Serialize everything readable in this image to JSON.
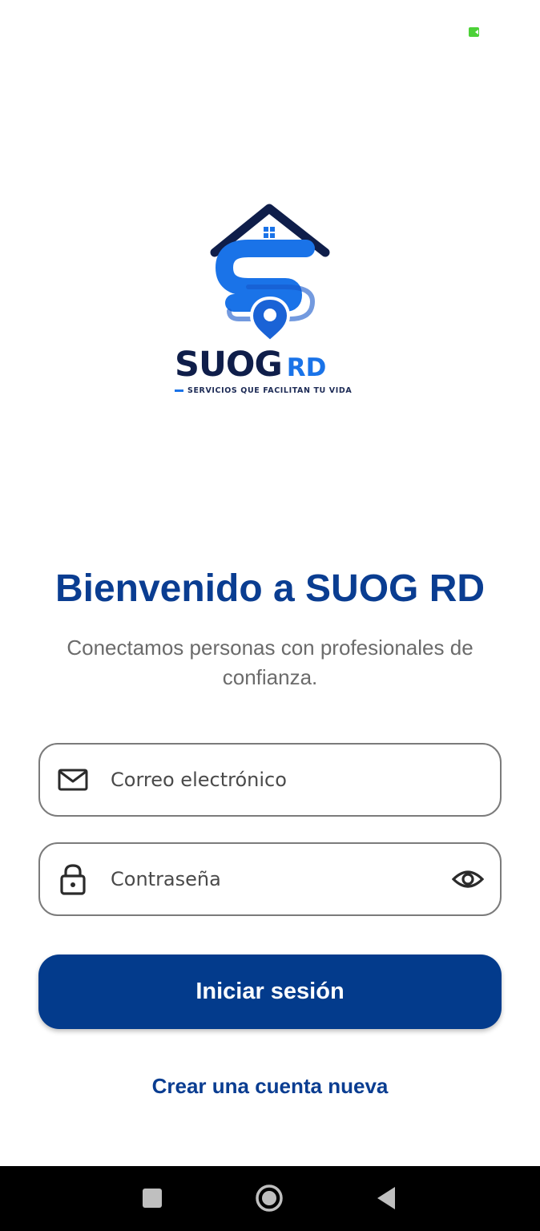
{
  "status_bar": {
    "indicator_icon": "camera-indicator-icon",
    "indicator_color": "#4cd137"
  },
  "logo": {
    "word": "SUOG",
    "suffix": "RD",
    "tagline": "SERVICIOS QUE FACILITAN TU VIDA",
    "colors": {
      "dark": "#0f1e4a",
      "blue": "#1a73e8"
    }
  },
  "welcome": {
    "title": "Bienvenido a SUOG RD",
    "subtitle": "Conectamos personas con profesionales de confianza."
  },
  "form": {
    "email": {
      "placeholder": "Correo electrónico",
      "value": "",
      "icon": "mail-icon"
    },
    "password": {
      "placeholder": "Contraseña",
      "value": "",
      "icon": "lock-icon",
      "toggle_icon": "eye-icon"
    },
    "login_label": "Iniciar sesión",
    "create_account_label": "Crear una cuenta nueva"
  },
  "theme": {
    "primary": "#033b8c",
    "title_color": "#0a3d91",
    "subtitle_color": "#6b6b6b"
  },
  "navbar": {
    "buttons": [
      "recents-icon",
      "home-icon",
      "back-icon"
    ]
  }
}
